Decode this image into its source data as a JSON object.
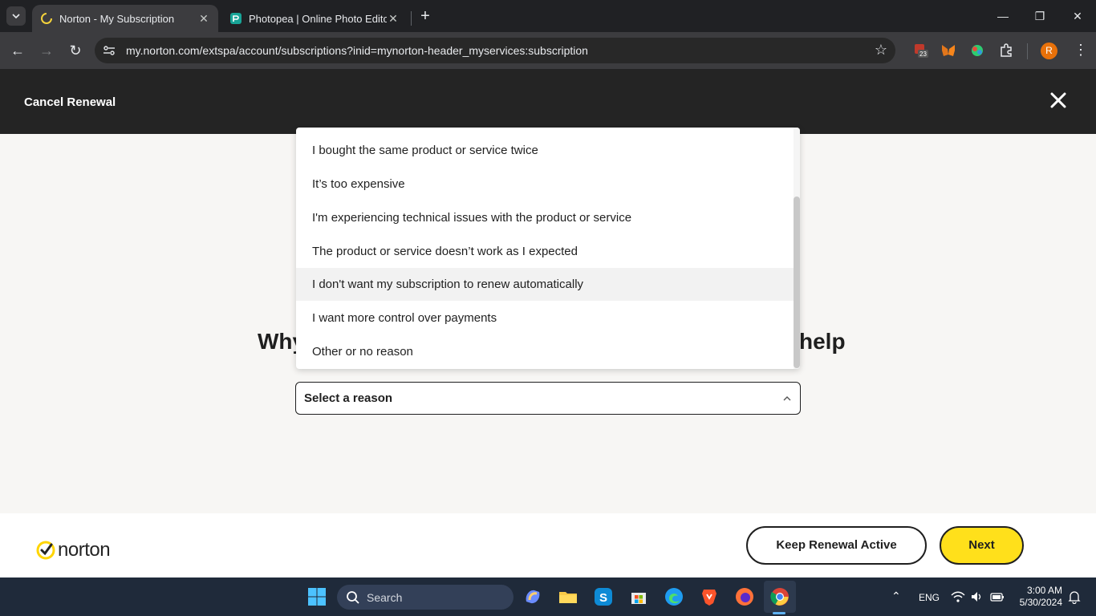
{
  "browser": {
    "tabs": [
      {
        "label": "Norton - My Subscription",
        "active": true
      },
      {
        "label": "Photopea | Online Photo Editor",
        "active": false
      }
    ],
    "url": "my.norton.com/extspa/account/subscriptions?inid=mynorton-header_myservices:subscription",
    "extension_badge": "23",
    "profile_initial": "R"
  },
  "header": {
    "title": "Cancel Renewal"
  },
  "question": {
    "left_fragment": "Why",
    "right_fragment": "help"
  },
  "select": {
    "value": "Select a reason"
  },
  "dropdown": {
    "options": [
      "I bought the same product or service twice",
      "It’s too expensive",
      "I'm experiencing technical issues with the product or service",
      "The product or service doesn’t work as I expected",
      "I don't want my subscription to renew automatically",
      "I want more control over payments",
      "Other or no reason"
    ],
    "highlighted_index": 4
  },
  "footer": {
    "logo_text": "norton",
    "keep_label": "Keep Renewal Active",
    "next_label": "Next"
  },
  "taskbar": {
    "search_label": "Search",
    "language": "ENG",
    "time": "3:00 AM",
    "date": "5/30/2024"
  },
  "colors": {
    "header_bg": "#242424",
    "next_button": "#ffe01b",
    "norton_check": "#ffd500"
  }
}
